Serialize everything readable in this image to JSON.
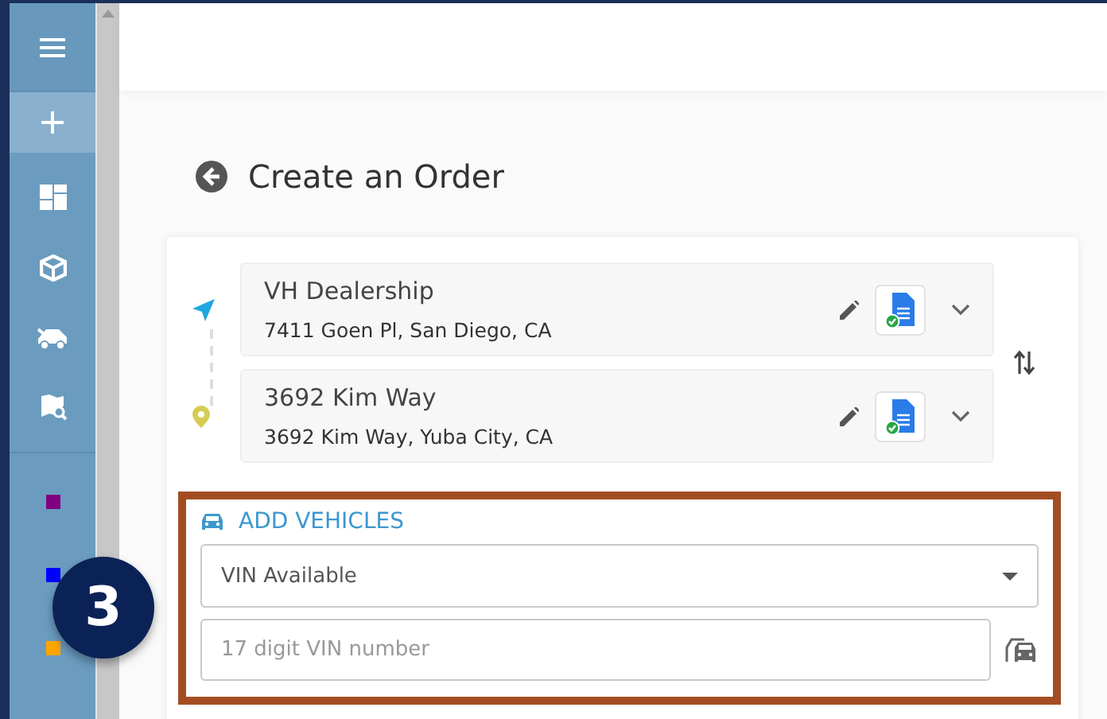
{
  "sidebar": {
    "items": [
      {
        "kind": "menu",
        "selected": false
      },
      {
        "kind": "add",
        "selected": true
      },
      {
        "kind": "dashboard",
        "selected": false
      },
      {
        "kind": "box",
        "selected": false
      },
      {
        "kind": "truck",
        "selected": false
      },
      {
        "kind": "map",
        "selected": false
      }
    ],
    "colors": [
      {
        "color": "#800080"
      },
      {
        "color": "#0000ff"
      },
      {
        "color": "#ffa500"
      }
    ]
  },
  "page": {
    "title": "Create an Order"
  },
  "stops": [
    {
      "kind": "origin",
      "name": "VH Dealership",
      "address": "7411 Goen Pl, San Diego, CA"
    },
    {
      "kind": "destination",
      "name": "3692 Kim Way",
      "address": "3692 Kim Way, Yuba City, CA"
    }
  ],
  "vehicles": {
    "heading": "ADD VEHICLES",
    "vin_mode": "VIN Available",
    "vin_placeholder": "17 digit VIN number"
  },
  "callout": {
    "number": "3"
  }
}
